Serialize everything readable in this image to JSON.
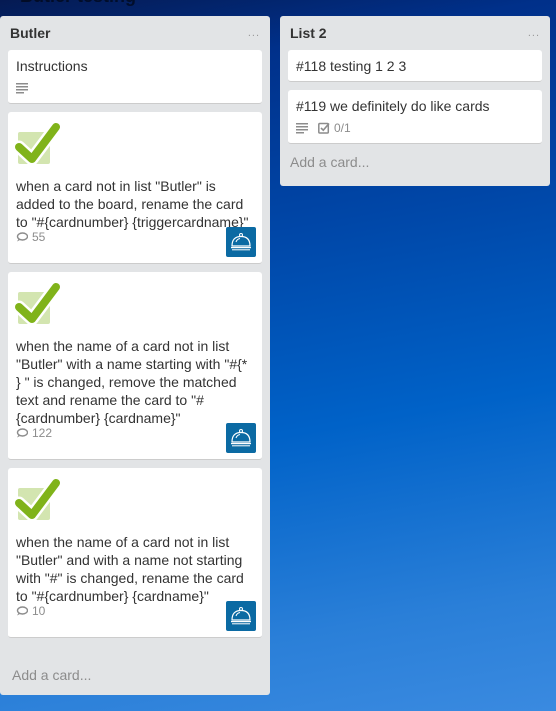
{
  "board": {
    "title_peek": "Butler testing"
  },
  "lists": [
    {
      "title": "Butler",
      "menu_label": "...",
      "add_card_label": "Add a card...",
      "cards": [
        {
          "title": "Instructions",
          "has_description": true
        },
        {
          "text": "when a card not in list \"Butler\" is added to the board, rename the card to \"#{cardnumber} {triggercardname}\"",
          "comments": "55",
          "icon": "check-icon",
          "button_icon": "butler-bell-icon"
        },
        {
          "text": "when the name of a card not in list \"Butler\" with a name starting with \"#{* } \" is changed, remove the matched text and rename the card to \"#{cardnumber} {cardname}\"",
          "comments": "122",
          "icon": "check-icon",
          "button_icon": "butler-bell-icon"
        },
        {
          "text": "when the name of a card not in list \"Butler\" and with a name not starting with \"#\" is changed, rename the card to \"#{cardnumber} {cardname}\"",
          "comments": "10",
          "icon": "check-icon",
          "button_icon": "butler-bell-icon"
        }
      ]
    },
    {
      "title": "List 2",
      "menu_label": "...",
      "add_card_label": "Add a card...",
      "cards": [
        {
          "title": "#118 testing 1 2 3"
        },
        {
          "title": "#119 we definitely do like cards",
          "has_description": true,
          "checklist": "0/1"
        }
      ]
    }
  ],
  "colors": {
    "list_bg": "#e2e4e6",
    "butler_button": "#0b6aa3",
    "check_green": "#7cb518",
    "check_bg": "#d9e8b8"
  }
}
